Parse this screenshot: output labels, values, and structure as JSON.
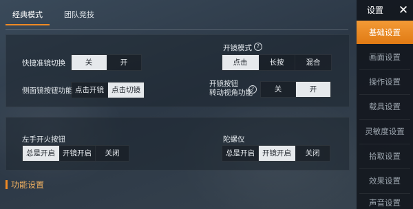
{
  "tabs": [
    {
      "label": "经典模式",
      "active": true
    },
    {
      "label": "团队竞技",
      "active": false
    }
  ],
  "basic": {
    "quick_scope": {
      "label": "快捷准镜切换",
      "options": [
        "关",
        "开"
      ],
      "selected": "关"
    },
    "side_scope": {
      "label": "侧面镜按钮功能",
      "options": [
        "点击开镜",
        "点击切镜"
      ],
      "selected": "点击切镜"
    },
    "scope_mode": {
      "label": "开镜模式",
      "options": [
        "点击",
        "长按",
        "混合"
      ],
      "selected": "点击"
    },
    "scope_rotate": {
      "label_line1": "开镜按钮",
      "label_line2": "转动视角功能",
      "options": [
        "关",
        "开"
      ],
      "selected": "开"
    }
  },
  "fire": {
    "left_fire": {
      "label": "左手开火按钮",
      "options": [
        "总是开启",
        "开镜开启",
        "关闭"
      ],
      "selected": "总是开启"
    },
    "gyro": {
      "label": "陀螺仪",
      "options": [
        "总是开启",
        "开镜开启",
        "关闭"
      ],
      "selected": "开镜开启"
    }
  },
  "section_title": "功能设置",
  "sidebar": {
    "title": "设置",
    "close_icon": "close-icon",
    "items": [
      {
        "label": "基础设置",
        "active": true
      },
      {
        "label": "画面设置",
        "active": false
      },
      {
        "label": "操作设置",
        "active": false
      },
      {
        "label": "载具设置",
        "active": false
      },
      {
        "label": "灵敏度设置",
        "active": false
      },
      {
        "label": "拾取设置",
        "active": false
      },
      {
        "label": "效果设置",
        "active": false
      },
      {
        "label": "声音设置",
        "active": false
      }
    ]
  },
  "colors": {
    "accent": "#f08a24",
    "selected_bg": "#e6e9ec"
  }
}
